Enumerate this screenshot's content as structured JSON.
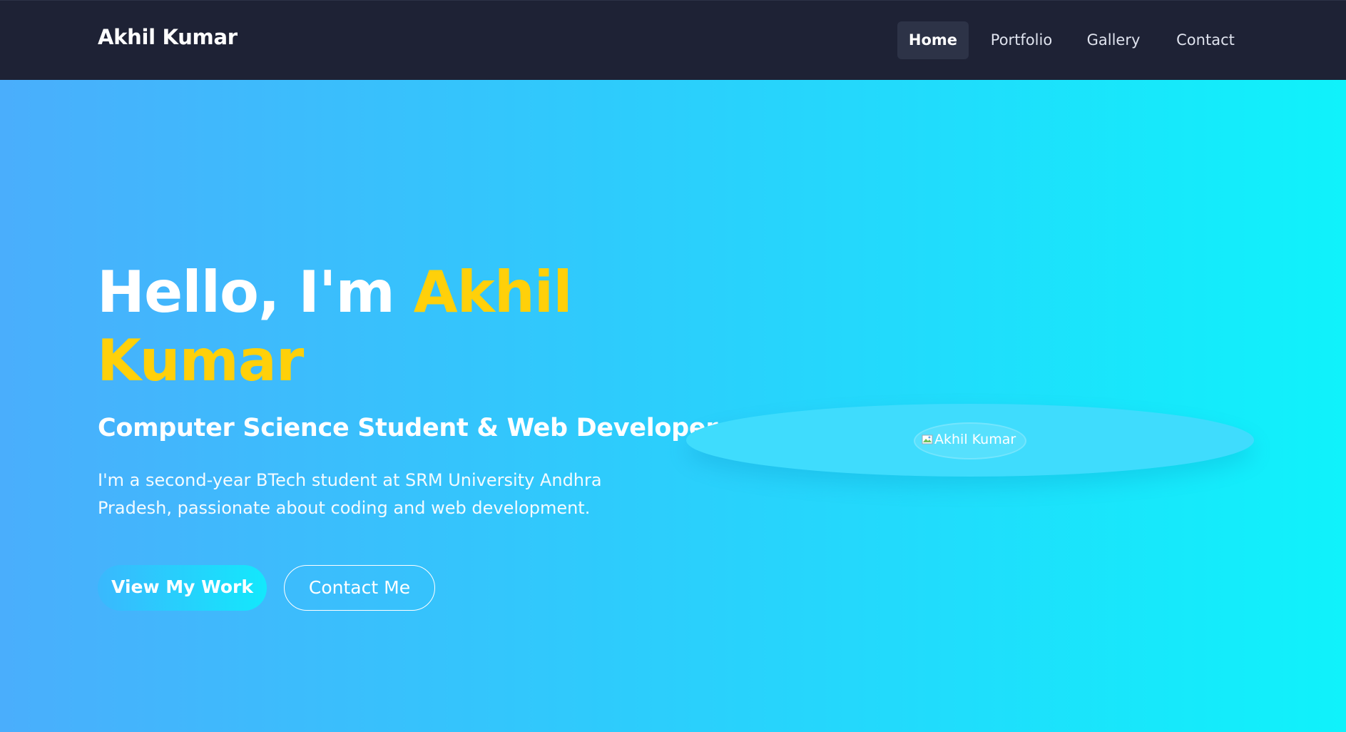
{
  "nav": {
    "brand": "Akhil Kumar",
    "links": [
      {
        "label": "Home",
        "active": true
      },
      {
        "label": "Portfolio",
        "active": false
      },
      {
        "label": "Gallery",
        "active": false
      },
      {
        "label": "Contact",
        "active": false
      }
    ]
  },
  "hero": {
    "title_prefix": "Hello, I'm ",
    "title_highlight": "Akhil Kumar",
    "subtitle": "Computer Science Student & Web Developer",
    "description": "I'm a second-year BTech student at SRM University Andhra Pradesh, passionate about coding and web development.",
    "primary_button": "View My Work",
    "secondary_button": "Contact Me",
    "profile_image_alt": "Akhil Kumar"
  },
  "colors": {
    "nav_bg": "#1e2235",
    "accent": "#ffd00a",
    "gradient_start": "#4aaefc",
    "gradient_end": "#0ff2fb"
  },
  "icons": {
    "profile_image": "broken-image-icon"
  }
}
